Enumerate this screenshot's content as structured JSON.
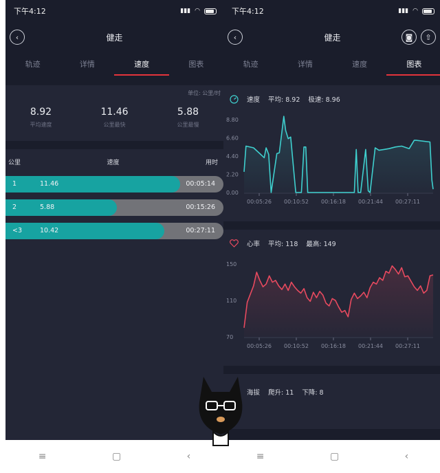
{
  "status": {
    "time": "下午4:12"
  },
  "app": {
    "title": "健走"
  },
  "tabs": [
    "轨迹",
    "详情",
    "速度",
    "图表"
  ],
  "left": {
    "active_tab": 2,
    "unit": "单位: 公里/时",
    "stats": [
      {
        "value": "8.92",
        "label": "平均速度"
      },
      {
        "value": "11.46",
        "label": "公里最快"
      },
      {
        "value": "5.88",
        "label": "公里最慢"
      }
    ],
    "table": {
      "headers": [
        "公里",
        "速度",
        "用时"
      ],
      "rows": [
        {
          "km": "1",
          "speed": "11.46",
          "time": "00:05:14",
          "fraction": 0.8
        },
        {
          "km": "2",
          "speed": "5.88",
          "time": "00:15:26",
          "fraction": 0.51
        },
        {
          "km": "<3",
          "speed": "10.42",
          "time": "00:27:11",
          "fraction": 0.73
        }
      ]
    }
  },
  "right": {
    "active_tab": 3,
    "speed_card": {
      "label": "速度",
      "avg": "平均: 8.92",
      "max": "极速: 8.96"
    },
    "heart_card": {
      "label": "心率",
      "avg": "平均: 118",
      "max": "最高: 149"
    },
    "altitude_card": {
      "label": "海拔",
      "up": "爬升: 11",
      "down": "下降: 8"
    }
  },
  "chart_data": [
    {
      "type": "area",
      "title": "速度",
      "x_ticks": [
        "00:05:26",
        "00:10:52",
        "00:16:18",
        "00:21:44",
        "00:27:11"
      ],
      "y_ticks": [
        "8.80",
        "6.60",
        "4.40",
        "2.20",
        "0.00"
      ],
      "ylim": [
        0,
        8.8
      ],
      "xlim": [
        0,
        30
      ],
      "color": "#3fd0cf",
      "x": [
        0,
        0.3,
        1.5,
        2.5,
        3.2,
        3.5,
        3.9,
        4.3,
        5.2,
        5.6,
        6.3,
        6.6,
        7,
        7.4,
        8.2,
        8.8,
        9.1,
        9.5,
        9.8,
        10.1,
        10.5,
        10.8,
        17.5,
        17.8,
        18.1,
        18.5,
        19.3,
        19.7,
        20,
        20.8,
        21.4,
        22.2,
        23,
        24,
        25,
        26.2,
        27,
        27.3,
        29.5,
        29.8,
        30
      ],
      "y": [
        2.5,
        5.6,
        5.4,
        4.7,
        4.2,
        5.4,
        4.6,
        0,
        4.7,
        4.8,
        9.2,
        7.5,
        6.5,
        6.7,
        0,
        0,
        0,
        5.5,
        5.5,
        0,
        0,
        0,
        0,
        5.2,
        0,
        0,
        5.2,
        0.2,
        0,
        5.4,
        5.1,
        5.2,
        5.3,
        5.5,
        5.6,
        5.3,
        6.3,
        6.3,
        6.1,
        1.5,
        0.4
      ]
    },
    {
      "type": "area",
      "title": "心率",
      "x_ticks": [
        "00:05:26",
        "00:10:52",
        "00:16:18",
        "00:21:44",
        "00:27:11"
      ],
      "y_ticks": [
        "150",
        "110",
        "70"
      ],
      "ylim": [
        70,
        150
      ],
      "xlim": [
        0,
        30
      ],
      "color": "#e84a5f",
      "x": [
        0,
        0.5,
        1,
        1.5,
        2,
        2.5,
        3,
        3.5,
        4,
        4.5,
        5,
        5.5,
        6,
        6.5,
        7,
        7.5,
        8,
        8.5,
        9,
        9.5,
        10,
        10.5,
        11,
        11.5,
        12,
        12.5,
        13,
        13.5,
        14,
        14.5,
        15,
        15.5,
        16,
        16.5,
        17,
        17.5,
        18,
        18.5,
        19,
        19.5,
        20,
        20.5,
        21,
        21.5,
        22,
        22.5,
        23,
        23.5,
        24,
        24.5,
        25,
        25.5,
        26,
        26.5,
        27,
        27.5,
        28,
        28.5,
        29,
        29.5,
        30
      ],
      "y": [
        80,
        108,
        117,
        126,
        141,
        132,
        125,
        128,
        137,
        130,
        132,
        126,
        122,
        128,
        121,
        130,
        125,
        121,
        118,
        123,
        113,
        109,
        119,
        113,
        120,
        116,
        107,
        104,
        112,
        110,
        103,
        97,
        99,
        92,
        111,
        118,
        112,
        115,
        119,
        113,
        124,
        130,
        128,
        135,
        132,
        142,
        140,
        148,
        144,
        139,
        146,
        136,
        137,
        131,
        125,
        121,
        126,
        118,
        121,
        137,
        138
      ]
    }
  ]
}
